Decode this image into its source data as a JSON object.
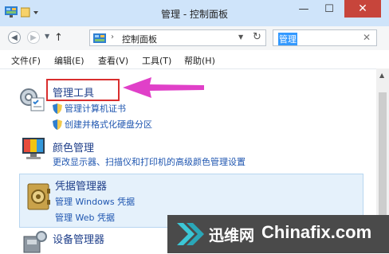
{
  "window": {
    "title": "管理 - 控制面板",
    "buttons": {
      "minimize": "—",
      "maximize": "☐",
      "close": "✕"
    }
  },
  "address_bar": {
    "path": "控制面板",
    "separator": "›",
    "search_value": "管理"
  },
  "menu": [
    "文件(F)",
    "编辑(E)",
    "查看(V)",
    "工具(T)",
    "帮助(H)"
  ],
  "items": {
    "admin_tools": {
      "title": "管理工具",
      "links": [
        "管理计算机证书",
        "创建并格式化硬盘分区"
      ]
    },
    "color_mgmt": {
      "title": "颜色管理",
      "description": "更改显示器、扫描仪和打印机的高级颜色管理设置"
    },
    "credential_mgr": {
      "title": "凭据管理器",
      "links": [
        "管理 Windows 凭据",
        "管理 Web 凭据"
      ]
    },
    "device_mgr": {
      "title": "设备管理器"
    }
  },
  "watermark": {
    "cn": "迅维网",
    "en": "Chinafix.com"
  },
  "colors": {
    "titlebar": "#cfe4fa",
    "link": "#1f56b0",
    "highlight_box": "#d92e2e",
    "arrow": "#e040c8",
    "selected_row": "#e5f1fb"
  },
  "icons": {
    "admin_tools": "admin-tools-icon",
    "color_mgmt": "color-management-icon",
    "credential_mgr": "credential-vault-icon",
    "device_mgr": "device-manager-icon",
    "shield": "uac-shield-icon"
  }
}
